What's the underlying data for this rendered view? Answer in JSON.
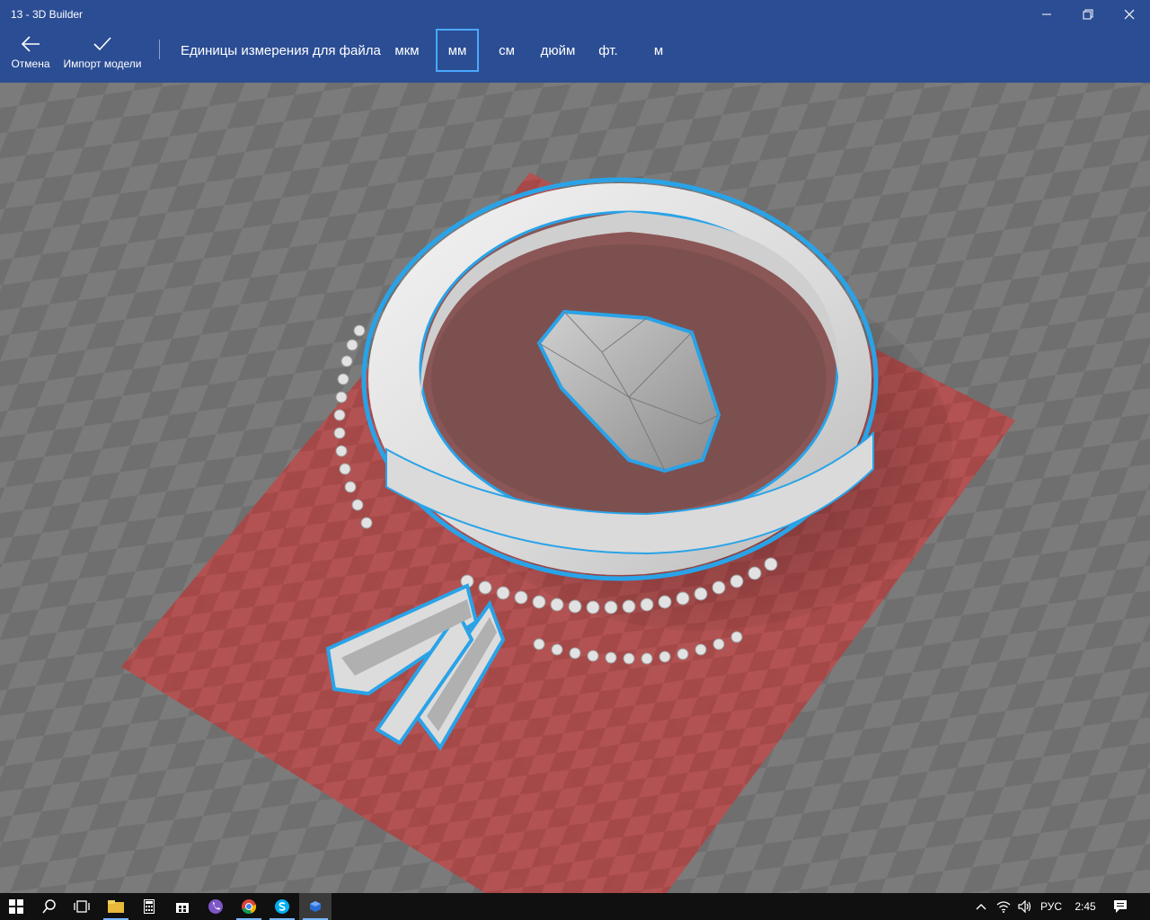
{
  "window": {
    "title": "13 - 3D Builder"
  },
  "toolbar": {
    "cancel_label": "Отмена",
    "cancel_icon": "back-arrow-icon",
    "import_label": "Импорт модели",
    "import_icon": "checkmark-icon",
    "units_label": "Единицы измерения для файла",
    "units": [
      "мкм",
      "мм",
      "см",
      "дюйм",
      "фт.",
      "м"
    ],
    "selected_unit": "мм"
  },
  "colors": {
    "accent_bar": "#2b4d94",
    "selection_border": "#4aa8ff",
    "model_outline": "#29a3e8",
    "build_plate": "#b44848"
  },
  "taskbar": {
    "apps": [
      "start-icon",
      "search-icon",
      "task-view-icon",
      "file-explorer-icon",
      "calculator-icon",
      "store-icon",
      "viber-icon",
      "chrome-icon",
      "skype-icon",
      "3d-builder-icon"
    ],
    "language": "РУС",
    "time": "2:45"
  }
}
